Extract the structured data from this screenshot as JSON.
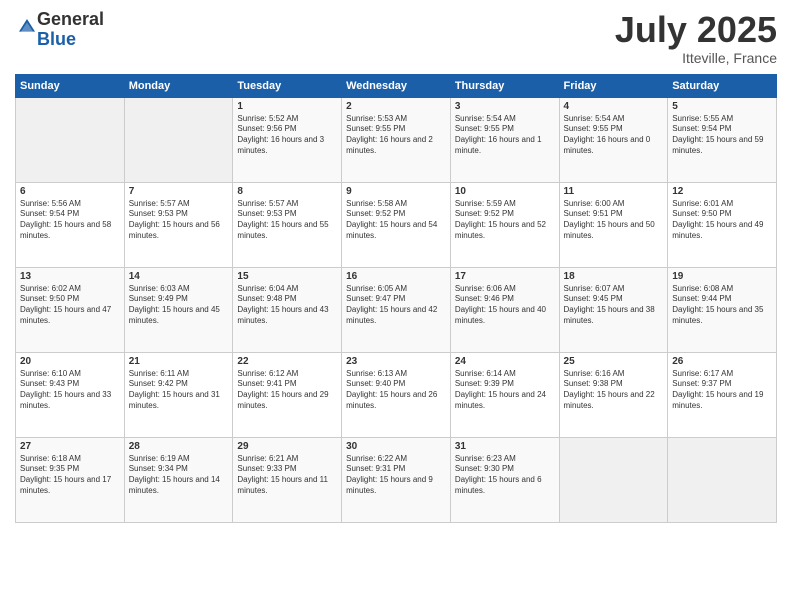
{
  "logo": {
    "general": "General",
    "blue": "Blue"
  },
  "header": {
    "month": "July 2025",
    "location": "Itteville, France"
  },
  "weekdays": [
    "Sunday",
    "Monday",
    "Tuesday",
    "Wednesday",
    "Thursday",
    "Friday",
    "Saturday"
  ],
  "weeks": [
    [
      {
        "day": "",
        "sunrise": "",
        "sunset": "",
        "daylight": ""
      },
      {
        "day": "",
        "sunrise": "",
        "sunset": "",
        "daylight": ""
      },
      {
        "day": "1",
        "sunrise": "Sunrise: 5:52 AM",
        "sunset": "Sunset: 9:56 PM",
        "daylight": "Daylight: 16 hours and 3 minutes."
      },
      {
        "day": "2",
        "sunrise": "Sunrise: 5:53 AM",
        "sunset": "Sunset: 9:55 PM",
        "daylight": "Daylight: 16 hours and 2 minutes."
      },
      {
        "day": "3",
        "sunrise": "Sunrise: 5:54 AM",
        "sunset": "Sunset: 9:55 PM",
        "daylight": "Daylight: 16 hours and 1 minute."
      },
      {
        "day": "4",
        "sunrise": "Sunrise: 5:54 AM",
        "sunset": "Sunset: 9:55 PM",
        "daylight": "Daylight: 16 hours and 0 minutes."
      },
      {
        "day": "5",
        "sunrise": "Sunrise: 5:55 AM",
        "sunset": "Sunset: 9:54 PM",
        "daylight": "Daylight: 15 hours and 59 minutes."
      }
    ],
    [
      {
        "day": "6",
        "sunrise": "Sunrise: 5:56 AM",
        "sunset": "Sunset: 9:54 PM",
        "daylight": "Daylight: 15 hours and 58 minutes."
      },
      {
        "day": "7",
        "sunrise": "Sunrise: 5:57 AM",
        "sunset": "Sunset: 9:53 PM",
        "daylight": "Daylight: 15 hours and 56 minutes."
      },
      {
        "day": "8",
        "sunrise": "Sunrise: 5:57 AM",
        "sunset": "Sunset: 9:53 PM",
        "daylight": "Daylight: 15 hours and 55 minutes."
      },
      {
        "day": "9",
        "sunrise": "Sunrise: 5:58 AM",
        "sunset": "Sunset: 9:52 PM",
        "daylight": "Daylight: 15 hours and 54 minutes."
      },
      {
        "day": "10",
        "sunrise": "Sunrise: 5:59 AM",
        "sunset": "Sunset: 9:52 PM",
        "daylight": "Daylight: 15 hours and 52 minutes."
      },
      {
        "day": "11",
        "sunrise": "Sunrise: 6:00 AM",
        "sunset": "Sunset: 9:51 PM",
        "daylight": "Daylight: 15 hours and 50 minutes."
      },
      {
        "day": "12",
        "sunrise": "Sunrise: 6:01 AM",
        "sunset": "Sunset: 9:50 PM",
        "daylight": "Daylight: 15 hours and 49 minutes."
      }
    ],
    [
      {
        "day": "13",
        "sunrise": "Sunrise: 6:02 AM",
        "sunset": "Sunset: 9:50 PM",
        "daylight": "Daylight: 15 hours and 47 minutes."
      },
      {
        "day": "14",
        "sunrise": "Sunrise: 6:03 AM",
        "sunset": "Sunset: 9:49 PM",
        "daylight": "Daylight: 15 hours and 45 minutes."
      },
      {
        "day": "15",
        "sunrise": "Sunrise: 6:04 AM",
        "sunset": "Sunset: 9:48 PM",
        "daylight": "Daylight: 15 hours and 43 minutes."
      },
      {
        "day": "16",
        "sunrise": "Sunrise: 6:05 AM",
        "sunset": "Sunset: 9:47 PM",
        "daylight": "Daylight: 15 hours and 42 minutes."
      },
      {
        "day": "17",
        "sunrise": "Sunrise: 6:06 AM",
        "sunset": "Sunset: 9:46 PM",
        "daylight": "Daylight: 15 hours and 40 minutes."
      },
      {
        "day": "18",
        "sunrise": "Sunrise: 6:07 AM",
        "sunset": "Sunset: 9:45 PM",
        "daylight": "Daylight: 15 hours and 38 minutes."
      },
      {
        "day": "19",
        "sunrise": "Sunrise: 6:08 AM",
        "sunset": "Sunset: 9:44 PM",
        "daylight": "Daylight: 15 hours and 35 minutes."
      }
    ],
    [
      {
        "day": "20",
        "sunrise": "Sunrise: 6:10 AM",
        "sunset": "Sunset: 9:43 PM",
        "daylight": "Daylight: 15 hours and 33 minutes."
      },
      {
        "day": "21",
        "sunrise": "Sunrise: 6:11 AM",
        "sunset": "Sunset: 9:42 PM",
        "daylight": "Daylight: 15 hours and 31 minutes."
      },
      {
        "day": "22",
        "sunrise": "Sunrise: 6:12 AM",
        "sunset": "Sunset: 9:41 PM",
        "daylight": "Daylight: 15 hours and 29 minutes."
      },
      {
        "day": "23",
        "sunrise": "Sunrise: 6:13 AM",
        "sunset": "Sunset: 9:40 PM",
        "daylight": "Daylight: 15 hours and 26 minutes."
      },
      {
        "day": "24",
        "sunrise": "Sunrise: 6:14 AM",
        "sunset": "Sunset: 9:39 PM",
        "daylight": "Daylight: 15 hours and 24 minutes."
      },
      {
        "day": "25",
        "sunrise": "Sunrise: 6:16 AM",
        "sunset": "Sunset: 9:38 PM",
        "daylight": "Daylight: 15 hours and 22 minutes."
      },
      {
        "day": "26",
        "sunrise": "Sunrise: 6:17 AM",
        "sunset": "Sunset: 9:37 PM",
        "daylight": "Daylight: 15 hours and 19 minutes."
      }
    ],
    [
      {
        "day": "27",
        "sunrise": "Sunrise: 6:18 AM",
        "sunset": "Sunset: 9:35 PM",
        "daylight": "Daylight: 15 hours and 17 minutes."
      },
      {
        "day": "28",
        "sunrise": "Sunrise: 6:19 AM",
        "sunset": "Sunset: 9:34 PM",
        "daylight": "Daylight: 15 hours and 14 minutes."
      },
      {
        "day": "29",
        "sunrise": "Sunrise: 6:21 AM",
        "sunset": "Sunset: 9:33 PM",
        "daylight": "Daylight: 15 hours and 11 minutes."
      },
      {
        "day": "30",
        "sunrise": "Sunrise: 6:22 AM",
        "sunset": "Sunset: 9:31 PM",
        "daylight": "Daylight: 15 hours and 9 minutes."
      },
      {
        "day": "31",
        "sunrise": "Sunrise: 6:23 AM",
        "sunset": "Sunset: 9:30 PM",
        "daylight": "Daylight: 15 hours and 6 minutes."
      },
      {
        "day": "",
        "sunrise": "",
        "sunset": "",
        "daylight": ""
      },
      {
        "day": "",
        "sunrise": "",
        "sunset": "",
        "daylight": ""
      }
    ]
  ]
}
